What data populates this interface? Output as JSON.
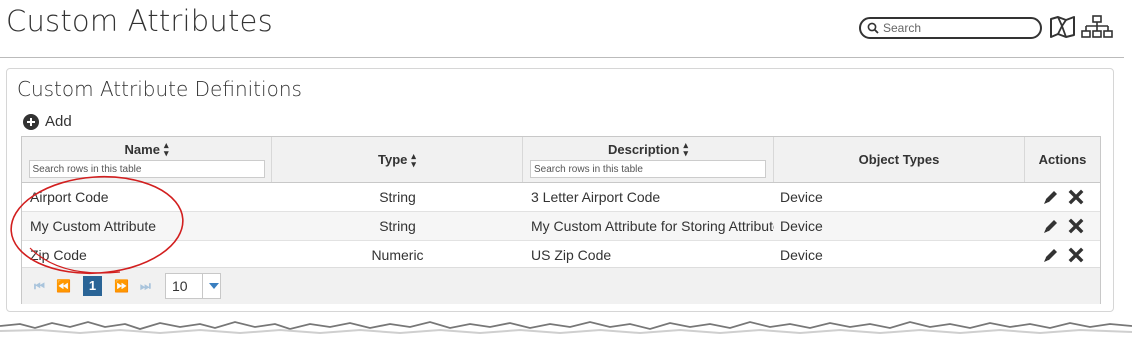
{
  "page": {
    "title": "Custom Attributes"
  },
  "header": {
    "search_placeholder": "Search",
    "icons": [
      "search-icon",
      "map-icon",
      "hierarchy-icon"
    ]
  },
  "panel": {
    "title": "Custom Attribute Definitions",
    "add_label": "Add"
  },
  "table": {
    "columns": [
      {
        "label": "Name",
        "sortable": true,
        "filter_placeholder": "Search rows in this table"
      },
      {
        "label": "Type",
        "sortable": true
      },
      {
        "label": "Description",
        "sortable": true,
        "filter_placeholder": "Search rows in this table"
      },
      {
        "label": "Object Types",
        "sortable": false
      },
      {
        "label": "Actions",
        "sortable": false
      }
    ],
    "rows": [
      {
        "name": "Airport Code",
        "type": "String",
        "description": "3 Letter Airport Code",
        "object_types": "Device"
      },
      {
        "name": "My Custom Attribute",
        "type": "String",
        "description": "My Custom Attribute for Storing Attribute",
        "object_types": "Device"
      },
      {
        "name": "Zip Code",
        "type": "Numeric",
        "description": "US Zip Code",
        "object_types": "Device"
      }
    ],
    "row_actions": [
      "edit-icon",
      "delete-icon"
    ]
  },
  "pager": {
    "current_page": "1",
    "page_size": "10",
    "controls": [
      "first-page-icon",
      "prev-page-icon",
      "next-page-icon",
      "last-page-icon"
    ]
  },
  "colors": {
    "accent": "#2a6496",
    "annotation": "#d21f1f",
    "header_bg": "#f1f1f1"
  }
}
